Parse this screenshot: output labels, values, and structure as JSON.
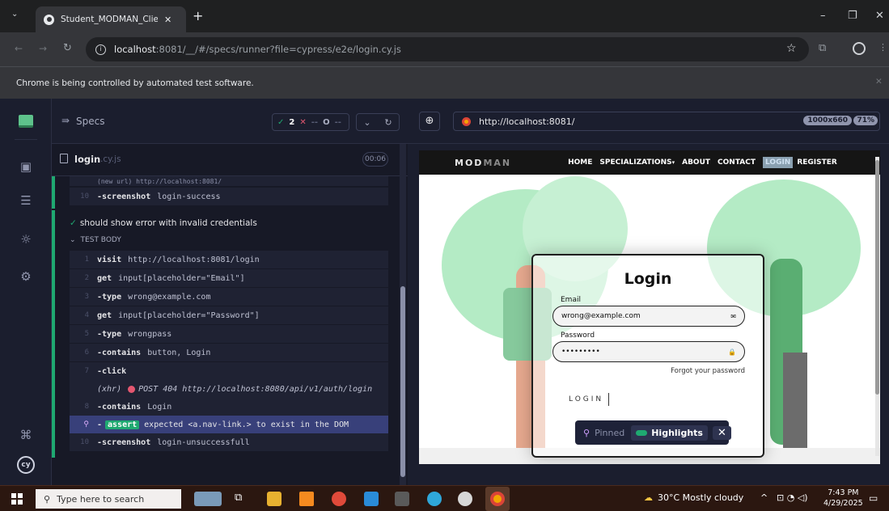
{
  "browser": {
    "tab_title": "Student_MODMAN_Client-main",
    "url_host": "localhost",
    "url_rest": ":8081/__/#/specs/runner?file=cypress/e2e/login.cy.js",
    "infobar_text": "Chrome is being controlled by automated test software.",
    "new_tab": "+"
  },
  "reporter": {
    "specs_label": "Specs",
    "passed_count": "2",
    "failed_icon": "✕",
    "pending_icon": "O",
    "spec_name": "login",
    "spec_ext": ".cy.js",
    "duration": "00:06",
    "truncated_line": "(new url) http://localhost:8081/",
    "prev_commands": [
      {
        "num": "10",
        "cmd": "-screenshot",
        "arg": "login-success"
      }
    ],
    "test_title": "should show error with invalid credentials",
    "test_body_label": "TEST BODY",
    "commands": [
      {
        "num": "1",
        "cmd": "visit",
        "arg": "http://localhost:8081/login"
      },
      {
        "num": "2",
        "cmd": "get",
        "arg": "input[placeholder=\"Email\"]"
      },
      {
        "num": "3",
        "cmd": "-type",
        "arg": "wrong@example.com"
      },
      {
        "num": "4",
        "cmd": "get",
        "arg": "input[placeholder=\"Password\"]"
      },
      {
        "num": "5",
        "cmd": "-type",
        "arg": "wrongpass"
      },
      {
        "num": "6",
        "cmd": "-contains",
        "arg": "button, Login"
      },
      {
        "num": "7",
        "cmd": "-click",
        "arg": ""
      }
    ],
    "xhr_label": "(xhr)",
    "xhr_text": "POST 404 http://localhost:8080/api/v1/auth/login",
    "cmd8": {
      "num": "8",
      "cmd": "-contains",
      "arg": "Login"
    },
    "assert_badge": "assert",
    "assert_text": "expected <a.nav-link.> to exist in the DOM",
    "cmd10": {
      "num": "10",
      "cmd": "-screenshot",
      "arg": "login-unsuccessfull"
    }
  },
  "preview": {
    "url": "http://localhost:8081/",
    "viewport": "1000x660",
    "zoom": "71%",
    "brand_a": "MOD",
    "brand_b": "MAN",
    "nav": [
      "HOME",
      "SPECIALIZATIONS",
      "ABOUT",
      "CONTACT",
      "LOGIN",
      "REGISTER"
    ],
    "nav_caret": "▾",
    "login_title": "Login",
    "email_label": "Email",
    "email_value": "wrong@example.com",
    "password_label": "Password",
    "password_value": "•••••••••",
    "forgot": "Forgot your password",
    "login_button": "LOGIN",
    "pinned": "Pinned",
    "highlights": "Highlights"
  },
  "taskbar": {
    "search_placeholder": "Type here to search",
    "weather": "30°C  Mostly cloudy",
    "time": "7:43 PM",
    "date": "4/29/2025"
  },
  "colors": {
    "cypress_green": "#1fa971",
    "cypress_red": "#e45770",
    "highlight": "#38407a"
  }
}
